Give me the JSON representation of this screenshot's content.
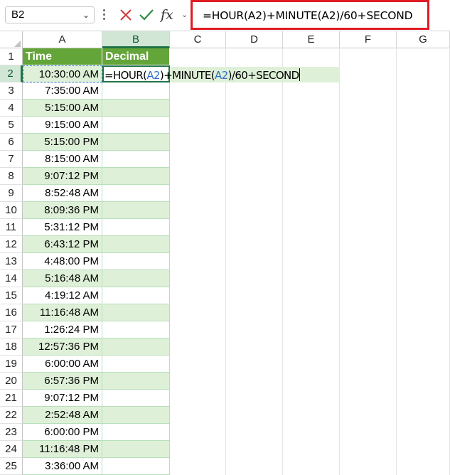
{
  "name_box": {
    "value": "B2"
  },
  "formula_bar": {
    "fx_label": "fx",
    "formula": "=HOUR(A2)+MINUTE(A2)/60+SECOND"
  },
  "columns": [
    "A",
    "B",
    "C",
    "D",
    "E",
    "F",
    "G"
  ],
  "active_column": "B",
  "active_row": "2",
  "header_row": {
    "row": "1",
    "a": "Time",
    "b": "Decimal"
  },
  "rows": [
    {
      "row": "2",
      "time": "10:30:00 AM"
    },
    {
      "row": "3",
      "time": "7:35:00 AM"
    },
    {
      "row": "4",
      "time": "5:15:00 AM"
    },
    {
      "row": "5",
      "time": "9:15:00 AM"
    },
    {
      "row": "6",
      "time": "5:15:00 PM"
    },
    {
      "row": "7",
      "time": "8:15:00 AM"
    },
    {
      "row": "8",
      "time": "9:07:12 PM"
    },
    {
      "row": "9",
      "time": "8:52:48 AM"
    },
    {
      "row": "10",
      "time": "8:09:36 PM"
    },
    {
      "row": "11",
      "time": "5:31:12 PM"
    },
    {
      "row": "12",
      "time": "6:43:12 PM"
    },
    {
      "row": "13",
      "time": "4:48:00 PM"
    },
    {
      "row": "14",
      "time": "5:16:48 AM"
    },
    {
      "row": "15",
      "time": "4:19:12 AM"
    },
    {
      "row": "16",
      "time": "11:16:48 AM"
    },
    {
      "row": "17",
      "time": "1:26:24 PM"
    },
    {
      "row": "18",
      "time": "12:57:36 PM"
    },
    {
      "row": "19",
      "time": "6:00:00 AM"
    },
    {
      "row": "20",
      "time": "6:57:36 PM"
    },
    {
      "row": "21",
      "time": "9:07:12 PM"
    },
    {
      "row": "22",
      "time": "2:52:48 AM"
    },
    {
      "row": "23",
      "time": "6:00:00 PM"
    },
    {
      "row": "24",
      "time": "11:16:48 PM"
    },
    {
      "row": "25",
      "time": "3:36:00 AM"
    }
  ],
  "edit_cell": {
    "prefix": "=HOUR(",
    "ref1": "A2",
    "middle": ")+MINUTE(",
    "ref2": "A2",
    "suffix": ")/60+SECOND"
  },
  "colors": {
    "header_fill": "#64a53a",
    "band_fill": "#dff0d8",
    "highlight_border": "#e01b24",
    "reference_color": "#2f6fca"
  }
}
